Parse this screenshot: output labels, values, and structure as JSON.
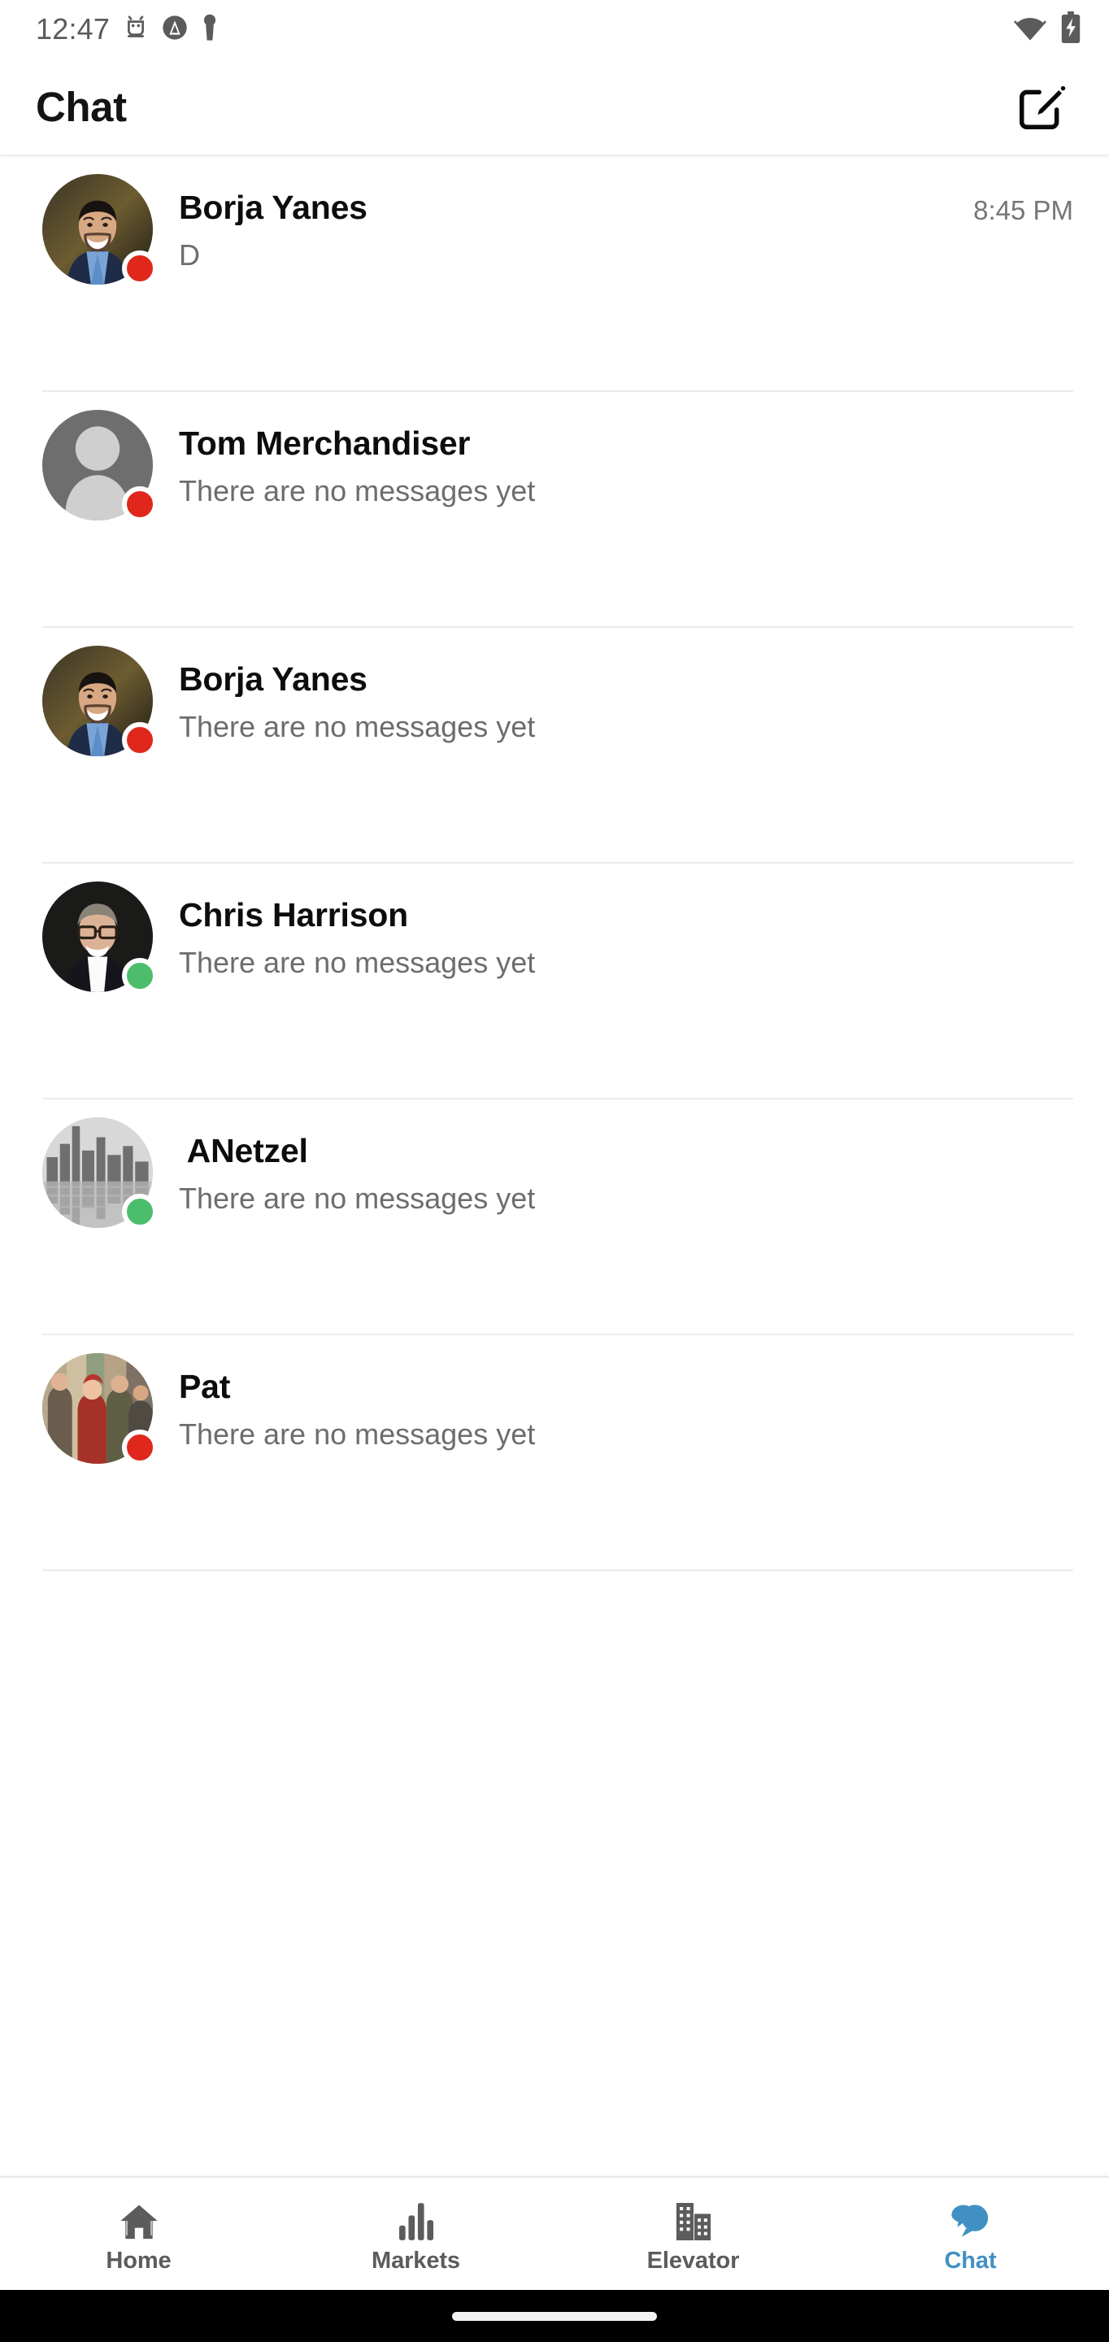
{
  "status_bar": {
    "time": "12:47",
    "icons": [
      "android-debug-icon",
      "vpn-key-icon",
      "usb-icon"
    ],
    "right_icons": [
      "wifi-icon",
      "battery-charging-icon"
    ]
  },
  "header": {
    "title": "Chat",
    "compose_icon": "compose-icon"
  },
  "colors": {
    "accent_blue": "#4190c3",
    "status_online": "#4cbd6d",
    "status_offline": "#e0271c",
    "divider": "#ececec",
    "title": "#0d0d0d",
    "preview": "#6d6d6d",
    "timestamp": "#767676"
  },
  "conversations": [
    {
      "name": "Borja Yanes",
      "preview": "D",
      "time": "8:45 PM",
      "status": "offline",
      "avatar": "photo-man-beard-suit"
    },
    {
      "name": "Tom Merchandiser",
      "preview": "There are no messages yet",
      "time": "",
      "status": "offline",
      "avatar": "default-person-placeholder"
    },
    {
      "name": "Borja Yanes",
      "preview": "There are no messages yet",
      "time": "",
      "status": "offline",
      "avatar": "photo-man-beard-suit"
    },
    {
      "name": "Chris Harrison",
      "preview": "There are no messages yet",
      "time": "",
      "status": "online",
      "avatar": "photo-man-glasses"
    },
    {
      "name": " ANetzel",
      "preview": "There are no messages yet",
      "time": "",
      "status": "online",
      "avatar": "photo-city-skyline-bw"
    },
    {
      "name": "Pat",
      "preview": "There are no messages yet",
      "time": "",
      "status": "offline",
      "avatar": "photo-group-people"
    }
  ],
  "bottom_nav": {
    "active_index": 3,
    "items": [
      {
        "label": "Home",
        "icon": "home-icon"
      },
      {
        "label": "Markets",
        "icon": "bar-chart-icon"
      },
      {
        "label": "Elevator",
        "icon": "building-icon"
      },
      {
        "label": "Chat",
        "icon": "chat-bubbles-icon"
      }
    ]
  }
}
